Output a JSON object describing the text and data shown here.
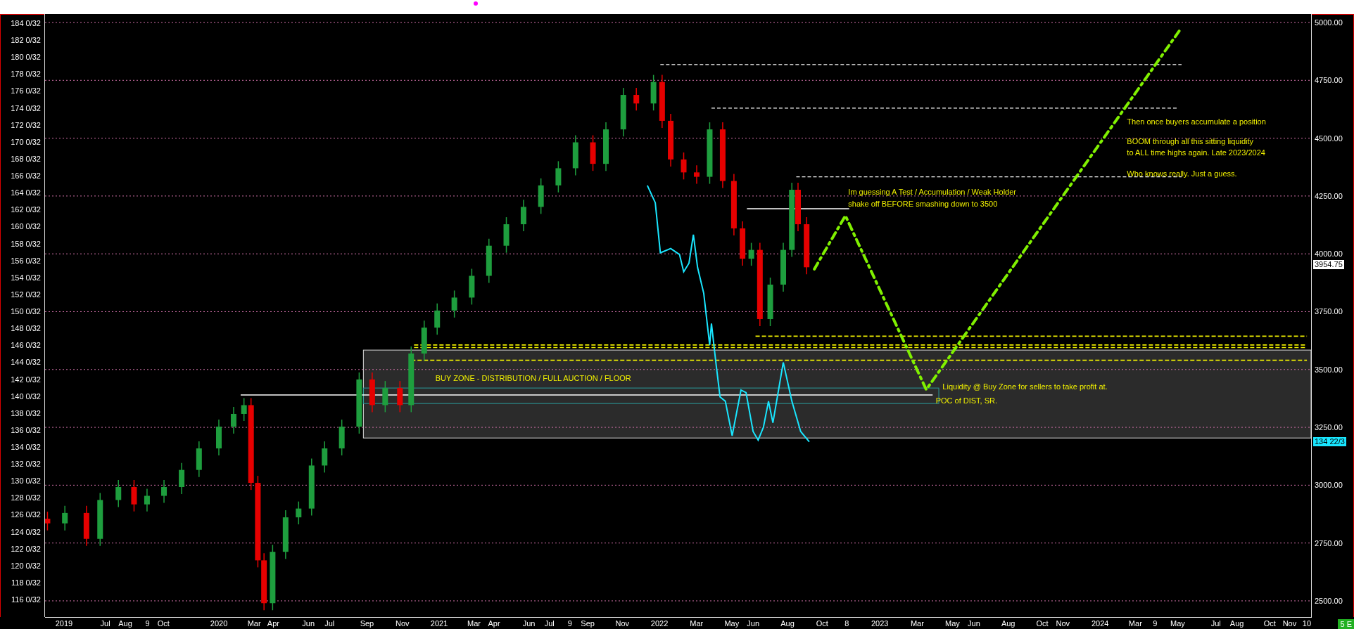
{
  "right_axis": [
    "5000.00",
    "4750.00",
    "4500.00",
    "4250.00",
    "4000.00",
    "3750.00",
    "3500.00",
    "3250.00",
    "3000.00",
    "2750.00",
    "2500.00"
  ],
  "left_axis": [
    "184 0/32",
    "182 0/32",
    "180 0/32",
    "178 0/32",
    "176 0/32",
    "174 0/32",
    "172 0/32",
    "170 0/32",
    "168 0/32",
    "166 0/32",
    "164 0/32",
    "162 0/32",
    "160 0/32",
    "158 0/32",
    "156 0/32",
    "154 0/32",
    "152 0/32",
    "150 0/32",
    "148 0/32",
    "146 0/32",
    "144 0/32",
    "142 0/32",
    "140 0/32",
    "138 0/32",
    "136 0/32",
    "134 0/32",
    "132 0/32",
    "130 0/32",
    "128 0/32",
    "126 0/32",
    "124 0/32",
    "122 0/32",
    "120 0/32",
    "118 0/32",
    "116 0/32"
  ],
  "time_axis": [
    "2019",
    "Jul",
    "Aug",
    "9",
    "Oct",
    "2020",
    "Mar",
    "Apr",
    "Jun",
    "Jul",
    "Sep",
    "Nov",
    "2021",
    "Mar",
    "Apr",
    "Jun",
    "Jul",
    "9",
    "Sep",
    "Nov",
    "2022",
    "Mar",
    "May",
    "Jun",
    "Aug",
    "Oct",
    "8",
    "2023",
    "Mar",
    "May",
    "Jun",
    "Aug",
    "Oct",
    "Nov",
    "2024",
    "Mar",
    "9",
    "May",
    "Jul",
    "Aug",
    "Oct",
    "Nov",
    "10"
  ],
  "notes": [
    "Then once buyers accumulate a position",
    "BOOM through all this sitting liquidity",
    "to ALL time highs again. Late 2023/2024",
    "Who knows really. Just a guess.",
    "Im guessing A Test / Accumulation / Weak Holder",
    "shake off BEFORE smashing down to 3500",
    "BUY ZONE - DISTRIBUTION / FULL AUCTION / FLOOR",
    "Liquidity @ Buy Zone for sellers to take profit at.",
    "POC of DIST, SR."
  ],
  "price_tags": [
    {
      "label": "3954.75",
      "kind": "last"
    },
    {
      "label": "134 22/3",
      "kind": "overlay"
    }
  ],
  "corner_badge": "5 E"
}
